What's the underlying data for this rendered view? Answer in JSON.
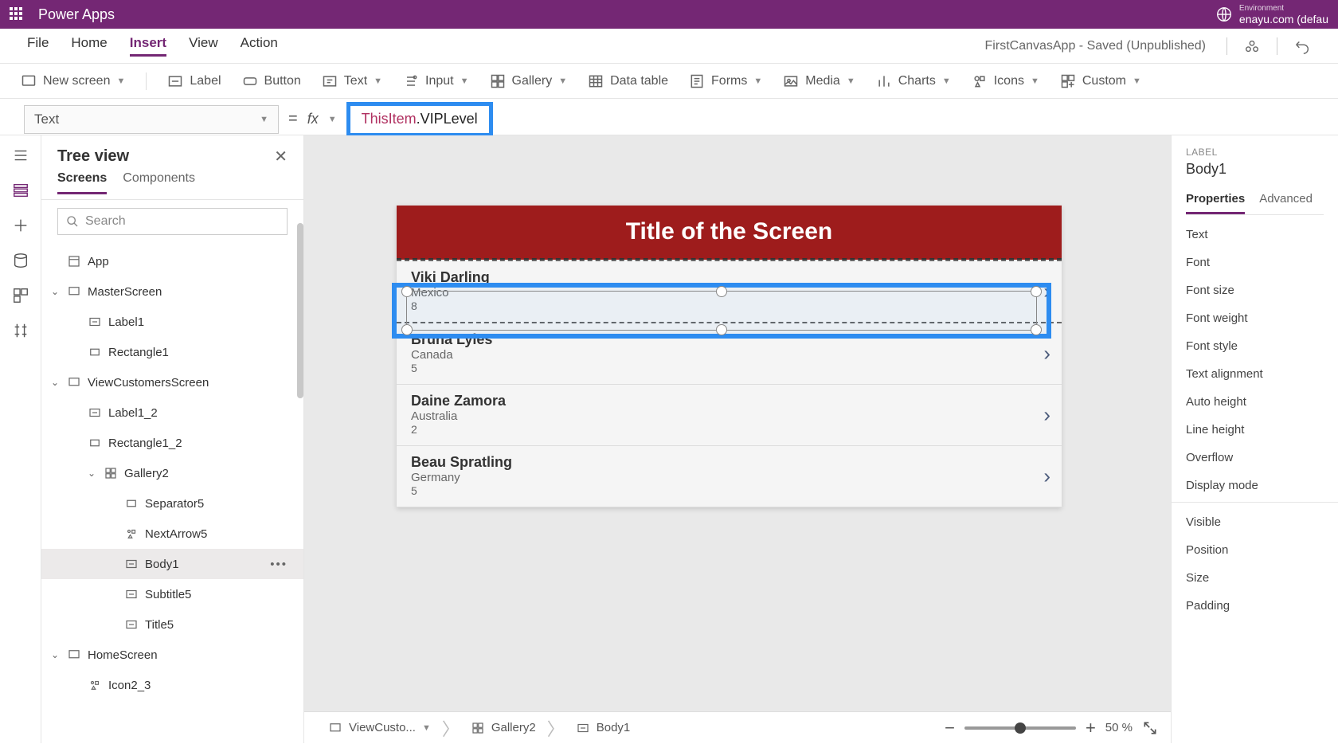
{
  "topbar": {
    "app_title": "Power Apps",
    "env_label": "Environment",
    "env_name": "enayu.com (defau"
  },
  "menubar": {
    "items": [
      {
        "label": "File"
      },
      {
        "label": "Home"
      },
      {
        "label": "Insert",
        "active": true
      },
      {
        "label": "View"
      },
      {
        "label": "Action"
      }
    ],
    "status": "FirstCanvasApp - Saved (Unpublished)"
  },
  "ribbon": {
    "items": [
      {
        "label": "New screen",
        "dropdown": true,
        "icon": "screen"
      },
      {
        "label": "Label",
        "icon": "label"
      },
      {
        "label": "Button",
        "icon": "button"
      },
      {
        "label": "Text",
        "dropdown": true,
        "icon": "text"
      },
      {
        "label": "Input",
        "dropdown": true,
        "icon": "input"
      },
      {
        "label": "Gallery",
        "dropdown": true,
        "icon": "gallery"
      },
      {
        "label": "Data table",
        "icon": "datatable"
      },
      {
        "label": "Forms",
        "dropdown": true,
        "icon": "forms"
      },
      {
        "label": "Media",
        "dropdown": true,
        "icon": "media"
      },
      {
        "label": "Charts",
        "dropdown": true,
        "icon": "charts"
      },
      {
        "label": "Icons",
        "dropdown": true,
        "icon": "icons"
      },
      {
        "label": "Custom",
        "dropdown": true,
        "icon": "custom"
      }
    ]
  },
  "formula": {
    "property": "Text",
    "this": "ThisItem",
    "field": "VIPLevel"
  },
  "tree": {
    "title": "Tree view",
    "tabs": {
      "screens": "Screens",
      "components": "Components"
    },
    "search_placeholder": "Search",
    "nodes": [
      {
        "label": "App",
        "depth": 0,
        "icon": "app"
      },
      {
        "label": "MasterScreen",
        "depth": 0,
        "icon": "screen",
        "expanded": true
      },
      {
        "label": "Label1",
        "depth": 1,
        "icon": "label"
      },
      {
        "label": "Rectangle1",
        "depth": 1,
        "icon": "rect"
      },
      {
        "label": "ViewCustomersScreen",
        "depth": 0,
        "icon": "screen",
        "expanded": true
      },
      {
        "label": "Label1_2",
        "depth": 1,
        "icon": "label"
      },
      {
        "label": "Rectangle1_2",
        "depth": 1,
        "icon": "rect"
      },
      {
        "label": "Gallery2",
        "depth": 1,
        "icon": "gallery",
        "expanded": true
      },
      {
        "label": "Separator5",
        "depth": 2,
        "icon": "rect"
      },
      {
        "label": "NextArrow5",
        "depth": 2,
        "icon": "icon"
      },
      {
        "label": "Body1",
        "depth": 2,
        "icon": "label",
        "selected": true
      },
      {
        "label": "Subtitle5",
        "depth": 2,
        "icon": "label"
      },
      {
        "label": "Title5",
        "depth": 2,
        "icon": "label"
      },
      {
        "label": "HomeScreen",
        "depth": 0,
        "icon": "screen",
        "expanded": true
      },
      {
        "label": "Icon2_3",
        "depth": 1,
        "icon": "icon"
      }
    ]
  },
  "canvas": {
    "screen_title": "Title of the Screen",
    "rows": [
      {
        "name": "Viki  Darling",
        "sub": "Mexico",
        "num": "8"
      },
      {
        "name": "Bruna  Lyles",
        "sub": "Canada",
        "num": "5"
      },
      {
        "name": "Daine  Zamora",
        "sub": "Australia",
        "num": "2"
      },
      {
        "name": "Beau  Spratling",
        "sub": "Germany",
        "num": "5"
      }
    ]
  },
  "breadcrumb": {
    "segs": [
      {
        "label": "ViewCusto...",
        "icon": "screen",
        "dropdown": true
      },
      {
        "label": "Gallery2",
        "icon": "gallery"
      },
      {
        "label": "Body1",
        "icon": "label"
      }
    ],
    "zoom": "50  %"
  },
  "props": {
    "label": "LABEL",
    "name": "Body1",
    "tabs": {
      "properties": "Properties",
      "advanced": "Advanced"
    },
    "items": [
      "Text",
      "Font",
      "Font size",
      "Font weight",
      "Font style",
      "Text alignment",
      "Auto height",
      "Line height",
      "Overflow",
      "Display mode"
    ],
    "items2": [
      "Visible",
      "Position",
      "Size",
      "Padding"
    ]
  }
}
